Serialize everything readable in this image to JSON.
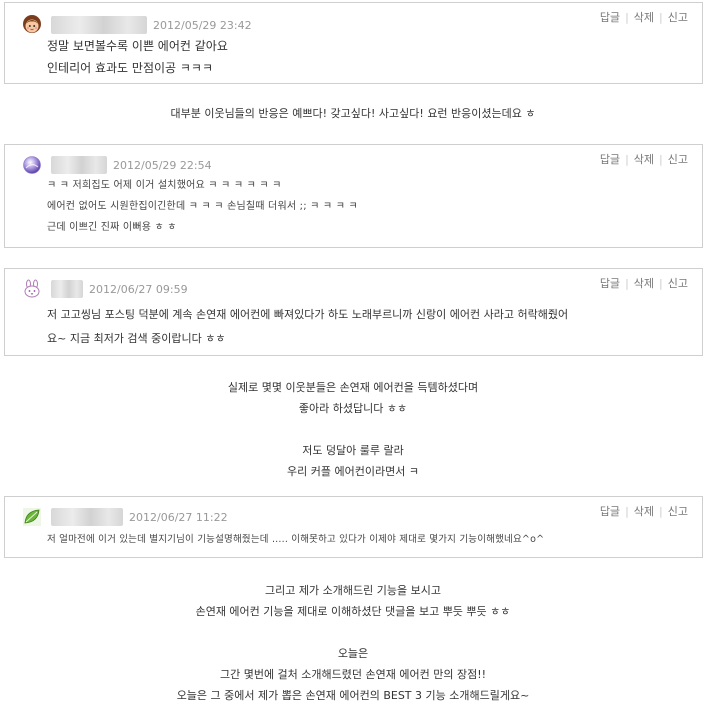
{
  "actions": {
    "reply": "답글",
    "delete": "삭제",
    "report": "신고",
    "sep": "|"
  },
  "comments": [
    {
      "avatar_icon": "girl-face-avatar-icon",
      "date": "2012/05/29 23:42",
      "lines": [
        "정말 보면볼수록 이쁜 에어컨 같아요",
        "인테리어 효과도 만점이공 ㅋㅋㅋ"
      ]
    },
    {
      "avatar_icon": "purple-orb-avatar-icon",
      "date": "2012/05/29 22:54",
      "lines": [
        "ㅋ ㅋ 저희집도 어제 이거 설치했어요 ㅋ ㅋ ㅋ ㅋ ㅋ ㅋ",
        "에어컨 없어도 시원한집이긴한데 ㅋ ㅋ ㅋ 손님칠때 더워서 ;; ㅋ ㅋ ㅋ ㅋ",
        "근데 이쁘긴 진짜 이뻐용 ㅎ ㅎ"
      ]
    },
    {
      "avatar_icon": "bunny-face-avatar-icon",
      "date": "2012/06/27 09:59",
      "lines": [
        "저 고고씽님 포스팅 덕분에 계속 손연재 에어컨에 빠져있다가 하도 노래부르니까 신랑이 에어컨 사라고 허락해줬어",
        "요~  지금 최저가 검색 중이랍니다 ㅎㅎ"
      ]
    },
    {
      "avatar_icon": "green-leaf-avatar-icon",
      "date": "2012/06/27 11:22",
      "lines": [
        "저 얼마전에 이거 있는데 별지기님이 기능설명해줬는데 ..... 이해못하고 있다가 이제야 제대로 몇가지 기능이해했네요^o^"
      ]
    }
  ],
  "paragraphs": [
    [
      "대부분 이웃님들의 반응은 예쁘다! 갖고싶다! 사고싶다! 요런 반응이셨는데요 ㅎ"
    ],
    [
      "실제로 몇몇 이웃분들은 손연재 에어컨을 득템하셨다며",
      "좋아라 하셨답니다 ㅎㅎ",
      "",
      "저도 덩달아 룰루 랄라",
      "우리 커플 에어컨이라면서 ㅋ"
    ],
    [
      "그리고 제가 소개해드린 기능을 보시고",
      "손연재 에어컨 기능을 제대로 이해하셨단 댓글을 보고 뿌듯 뿌듯 ㅎㅎ",
      "",
      "오늘은",
      "그간 몇번에 걸처 소개해드렸던 손연재 에어컨 만의 장점!!",
      "오늘은 그 중에서 제가 뽑은 손연재 에어컨의 BEST 3 기능 소개해드릴게요~"
    ]
  ]
}
